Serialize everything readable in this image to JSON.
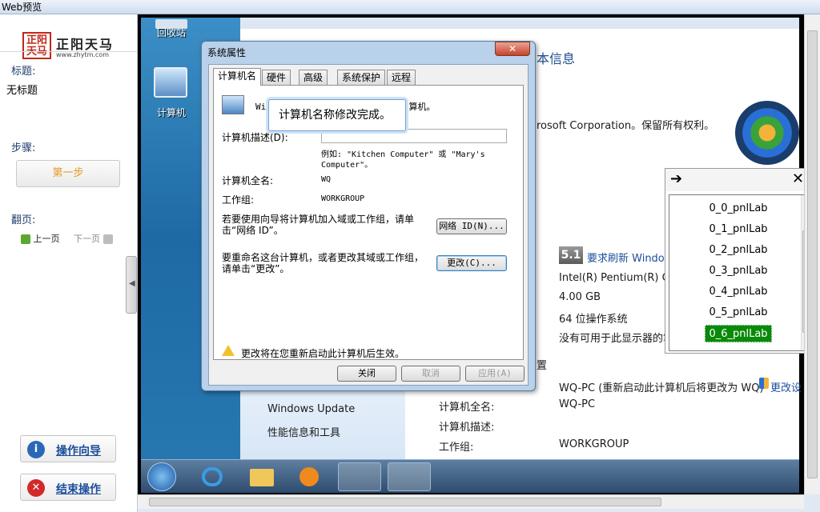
{
  "window": {
    "title": "Web预览"
  },
  "logo": {
    "mark": "正阳天马",
    "name": "正阳天马",
    "url": "www.zhytm.com"
  },
  "left": {
    "title_label": "标题:",
    "title_value": "无标题",
    "steps_label": "步骤:",
    "step1": "第一步",
    "paging_label": "翻页:",
    "prev": "上一页",
    "next": "下一页",
    "guide_button": "操作向导",
    "end_button": "结束操作"
  },
  "desktop": {
    "recycle_label": "回收站",
    "computer_label": "计算机"
  },
  "control_panel": {
    "heading_partial": "本信息",
    "copyright_partial": "rosoft Corporation。保留所有权利。",
    "score": "5.1",
    "refresh_link": "要求刷新 Windows",
    "cpu": "Intel(R) Pentium(R) CPU",
    "ram": "4.00 GB",
    "os_type": "64 位操作系统",
    "pen": "没有可用于此显示器的笔",
    "settings_partial": "置",
    "computer_name_value": "WQ-PC (重新启动此计算机后将更改为 WQ)",
    "change_settings": "更改设",
    "full_name_label": "计算机全名:",
    "full_name_value": "WQ-PC",
    "desc_label": "计算机描述:",
    "workgroup_label": "工作组:",
    "workgroup_value": "WORKGROUP",
    "side_links": [
      "Windows Update",
      "性能信息和工具"
    ]
  },
  "dialog": {
    "title": "系统属性",
    "tabs": [
      "计算机名",
      "硬件",
      "高级",
      "系统保护",
      "远程"
    ],
    "intro_partial": "Win        使用以下信息在网络上标识这台计算机。",
    "desc_label": "计算机描述(D):",
    "example": "例如: \"Kitchen Computer\" 或 \"Mary's Computer\"。",
    "fullname_label": "计算机全名:",
    "fullname_value": "WQ",
    "workgroup_label": "工作组:",
    "workgroup_value": "WORKGROUP",
    "wizard_text": "若要使用向导将计算机加入域或工作组，请单击“网络 ID”。",
    "network_id_button": "网络 ID(N)...",
    "rename_text": "要重命名这台计算机，或者更改其域或工作组，请单击“更改”。",
    "change_button": "更改(C)...",
    "warning": "更改将在您重新启动此计算机后生效。",
    "close_button": "关闭",
    "cancel_button": "取消",
    "apply_button": "应用(A)"
  },
  "tooltip": {
    "text": "计算机名称修改完成。"
  },
  "listbox": {
    "items": [
      "0_0_pnlLab",
      "0_1_pnlLab",
      "0_2_pnlLab",
      "0_3_pnlLab",
      "0_4_pnlLab",
      "0_5_pnlLab",
      "0_6_pnlLab"
    ],
    "selected_index": 6,
    "arrow": "➔",
    "close": "✕"
  },
  "colors": {
    "accent": "#1b4e9b",
    "selected": "#0a8a0a",
    "step": "#e39b24"
  }
}
